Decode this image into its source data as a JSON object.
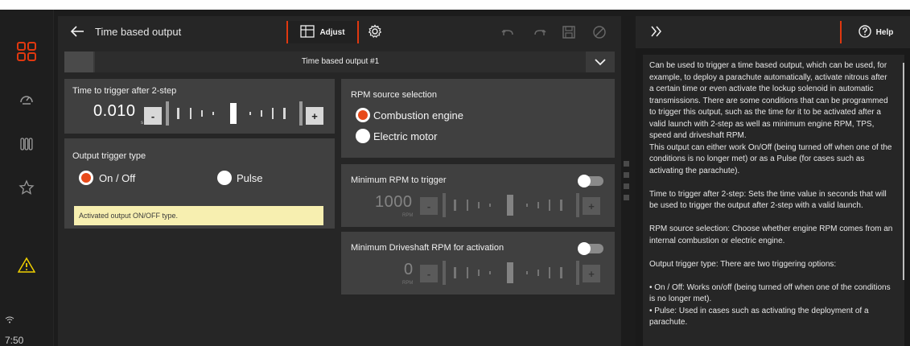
{
  "status": {
    "time": "7:50"
  },
  "header": {
    "title": "Time based output",
    "adjust_label": "Adjust"
  },
  "selector": {
    "value": "Time based output #1"
  },
  "time_trigger": {
    "label": "Time to trigger after 2-step",
    "value": "0.010",
    "unit": "s",
    "minus": "-",
    "plus": "+"
  },
  "output_trigger": {
    "label": "Output trigger type",
    "options": [
      {
        "label": "On / Off",
        "selected": true
      },
      {
        "label": "Pulse",
        "selected": false
      }
    ],
    "note": "Activated output ON/OFF type."
  },
  "rpm_source": {
    "label": "RPM source selection",
    "options": [
      {
        "label": "Combustion engine",
        "selected": true
      },
      {
        "label": "Electric motor",
        "selected": false
      }
    ]
  },
  "min_rpm": {
    "label": "Minimum RPM to trigger",
    "value": "1000",
    "unit": "RPM",
    "minus": "-",
    "plus": "+",
    "enabled": false
  },
  "min_driveshaft": {
    "label": "Minimum Driveshaft RPM for activation",
    "value": "0",
    "unit": "RPM",
    "minus": "-",
    "plus": "+",
    "enabled": false
  },
  "help": {
    "button_label": "Help",
    "paragraphs": [
      "Can be used to trigger a time based output, which can be used, for example, to deploy a parachute automatically, activate nitrous after a certain time or even activate the lockup solenoid in automatic transmissions. There are some conditions that can be programmed to trigger this output, such as the time for it to be activated after a valid launch with 2-step as well as minimum engine RPM, TPS, speed and driveshaft RPM.",
      "This output can either work On/Off (being turned off when one of the conditions is no longer met) or as a Pulse (for cases such as activating the parachute).",
      "",
      "Time to trigger after 2-step: Sets the time value in seconds that will be used to trigger the output after 2-step with a valid launch.",
      "",
      "RPM source selection: Choose whether engine RPM comes from an internal combustion or electric engine.",
      "",
      "Output trigger type: There are two triggering options:",
      "",
      "• On / Off: Works on/off (being turned off when one of the conditions is no longer met).",
      "• Pulse: Used in cases such as activating the deployment of a parachute."
    ]
  },
  "colors": {
    "accent": "#e0380f",
    "radio_on": "#e84a1a",
    "note_bg": "#f7efb0"
  }
}
